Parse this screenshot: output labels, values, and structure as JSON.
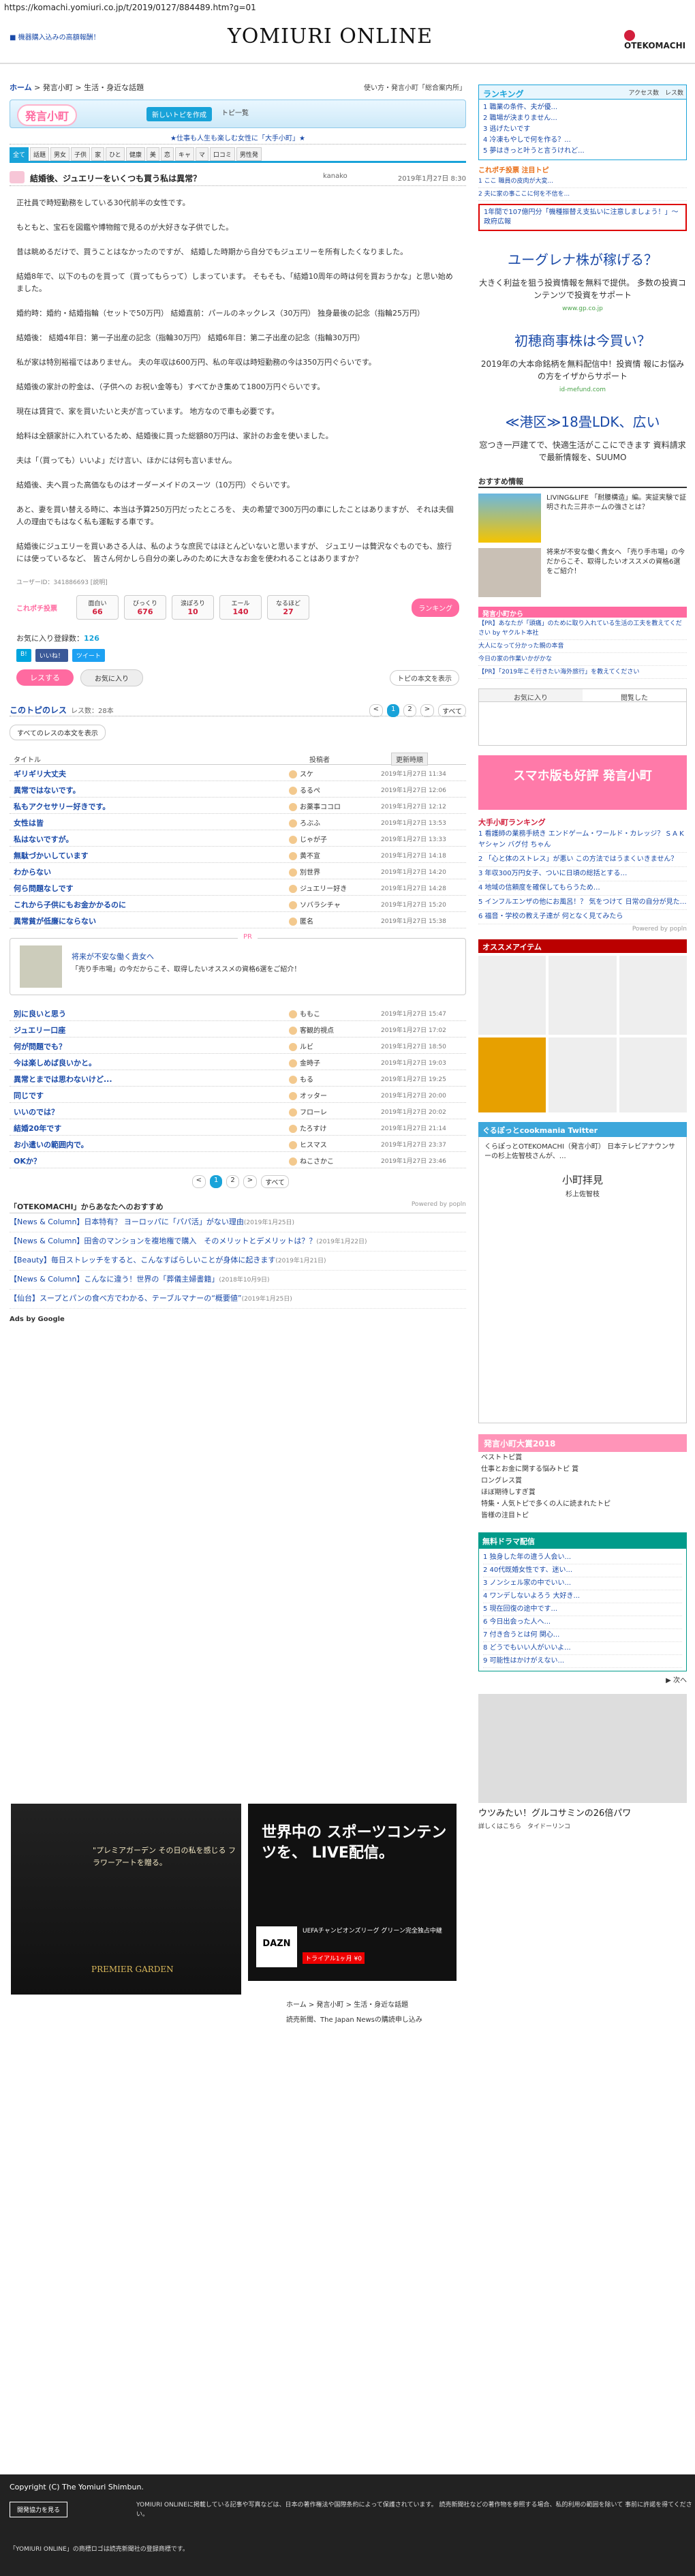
{
  "url": "https://komachi.yomiuri.co.jp/t/2019/0127/884489.htm?g=01",
  "top_link": "■ 機器購入込みの高額報酬！",
  "logo": "YOMIURI ONLINE",
  "otek": "OTEKOMACHI",
  "crumb": {
    "home": "ホーム",
    "path": " > 発言小町 > 生活・身近な話題",
    "right": "使い方・発言小町「総合案内所」"
  },
  "banner": {
    "logo": "発言小町",
    "new_topic": "新しいトピを作成",
    "button2": "トピ一覧"
  },
  "tagline": "★仕事も人生も楽しむ女性に「大手小町」★",
  "cat_tabs": [
    "全て",
    "話題",
    "男女",
    "子供",
    "家",
    "ひと",
    "健康",
    "美",
    "恋",
    "キャ",
    "マ",
    "口コミ",
    "男性発"
  ],
  "topic": {
    "title": "結婚後、ジュエリーをいくつも買う私は異常？",
    "user": "kanako",
    "date": "2019年1月27日 8:30"
  },
  "body": [
    "正社員で時短勤務をしている30代前半の女性です。",
    "もともと、宝石を図鑑や博物館で見るのが大好きな子供でした。",
    "昔は眺めるだけで、買うことはなかったのですが、 結婚した時期から自分でもジュエリーを所有したくなりました。",
    "結婚8年で、以下のものを買って（買ってもらって）しまっています。 そもそも、「結婚10周年の時は何を買おうかな」と思い始めました。",
    "婚約時：婚約・結婚指輪（セットで50万円） 結婚直前：パールのネックレス（30万円） 独身最後の記念（指輪25万円）",
    "結婚後： 結婚4年目：第一子出産の記念（指輪30万円） 結婚6年目：第二子出産の記念（指輪30万円）",
    "私が家は特別裕福ではありません。 夫の年収は600万円、私の年収は時短勤務の今は350万円ぐらいです。",
    "結婚後の家計の貯金は、（子供への お祝い金等も）すべてかき集めて1800万円ぐらいです。",
    "現在は賃貸で、家を買いたいと夫が言っています。 地方なので車も必要です。",
    "給料は全額家計に入れているため、結婚後に買った総額80万円は、家計のお金を使いました。",
    "夫は「（買っても）いいよ」だけ言い、ほかには何も言いません。",
    "結婚後、夫へ買った高価なものはオーダーメイドのスーツ（10万円）ぐらいです。",
    "あと、妻を買い替える時に、本当は予算250万円だったところを、 夫の希望で300万円の車にしたことはありますが、 それは夫個人の理由でもはなく私も運転する車です。",
    "結婚後にジュエリーを買いあさる人は、私のような庶民ではほとんどいないと思いますが、 ジュエリーは贅沢なぐものでも、旅行には使っているなど、 皆さん何かしら自分の楽しみのために大きなお金を使われることはありますか？"
  ],
  "user_id": "ユーザーID：341886693 [説明]",
  "reactions": {
    "label": "これポチ投票",
    "items": [
      {
        "name": "面白い",
        "count": "66"
      },
      {
        "name": "びっくり",
        "count": "676"
      },
      {
        "name": "涙ぽろり",
        "count": "10"
      },
      {
        "name": "エール",
        "count": "140"
      },
      {
        "name": "なるほど",
        "count": "27"
      }
    ],
    "ranking": "ランキング"
  },
  "fav": {
    "label": "お気に入り登録数：",
    "count": "126"
  },
  "share": [
    "B!",
    "いいね！",
    "ツイート"
  ],
  "actions": {
    "res": "レスする",
    "fav": "お気に入り",
    "top": "トピの本文を表示"
  },
  "res_head": {
    "title": "このトピのレス",
    "count": "レス数：28本"
  },
  "pager": [
    "<",
    "1",
    "2",
    ">",
    "すべて"
  ],
  "all_res": "すべてのレスの本文を表示",
  "list_head": {
    "title": "タイトル",
    "user": "投稿者",
    "sort": "更新時順"
  },
  "res": [
    {
      "t": "ギリギリ大丈夫",
      "u": "スケ",
      "d": "2019年1月27日 11:34"
    },
    {
      "t": "異常ではないです。",
      "u": "るるぺ",
      "d": "2019年1月27日 12:06"
    },
    {
      "t": "私もアクセサリー好きです。",
      "u": "お薬事ココロ",
      "d": "2019年1月27日 12:12"
    },
    {
      "t": "女性は皆",
      "u": "ろぶふ",
      "d": "2019年1月27日 13:53"
    },
    {
      "t": "私はないですが。",
      "u": "じゃが子",
      "d": "2019年1月27日 13:33"
    },
    {
      "t": "無駄づかいしています",
      "u": "黄不宣",
      "d": "2019年1月27日 14:18"
    },
    {
      "t": "わからない",
      "u": "別世界",
      "d": "2019年1月27日 14:20"
    },
    {
      "t": "何ら問題なしです",
      "u": "ジュエリー好き",
      "d": "2019年1月27日 14:28"
    },
    {
      "t": "これから子供にもお金かかるのに",
      "u": "ソバラシチャ",
      "d": "2019年1月27日 15:20"
    },
    {
      "t": "異常貧が低廉にならない",
      "u": "匿名",
      "d": "2019年1月27日 15:38"
    }
  ],
  "pr": {
    "label": "PR",
    "title": "将来が不安な働く貴女へ",
    "sub": "「売り手市場」の今だからこそ、取得したいオススメの資格6選をご紹介！"
  },
  "res2": [
    {
      "t": "別に良いと思う",
      "u": "ももこ",
      "d": "2019年1月27日 15:47"
    },
    {
      "t": "ジュエリー口座",
      "u": "客観的視点",
      "d": "2019年1月27日 17:02"
    },
    {
      "t": "何が問題でも？",
      "u": "ルビ",
      "d": "2019年1月27日 18:50"
    },
    {
      "t": "今は楽しめば良いかと。",
      "u": "金時子",
      "d": "2019年1月27日 19:03"
    },
    {
      "t": "異常とまでは思わないけど...",
      "u": "もる",
      "d": "2019年1月27日 19:25"
    },
    {
      "t": "同じです",
      "u": "オッター",
      "d": "2019年1月27日 20:00"
    },
    {
      "t": "いいのでは？",
      "u": "フローレ",
      "d": "2019年1月27日 20:02"
    },
    {
      "t": "結婚20年です",
      "u": "たろすけ",
      "d": "2019年1月27日 21:14"
    },
    {
      "t": "お小遣いの範囲内で。",
      "u": "ヒスマス",
      "d": "2019年1月27日 23:37"
    },
    {
      "t": "OKか？",
      "u": "ねこさかこ",
      "d": "2019年1月27日 23:46"
    }
  ],
  "rec": {
    "head": "「OTEKOMACHI」からあなたへのおすすめ",
    "powered": "Powered by popln",
    "items": [
      {
        "t": "【News & Column】日本特有？ ヨーロッパに「パパ活」がない理由",
        "d": "(2019年1月25日)"
      },
      {
        "t": "【News & Column】田舎のマンションを複地権で購入　そのメリットとデメリットは？？",
        "d": "(2019年1月22日)"
      },
      {
        "t": "【Beauty】毎日ストレッチをすると、こんなすばらしいことが身体に起きます",
        "d": "(2019年1月21日)"
      },
      {
        "t": "【News & Column】こんなに違う！世界の「葬儀主婦書籍」",
        "d": "(2018年10月9日)"
      },
      {
        "t": "【仙台】スープとパンの食べ方でわかる、テーブルマナーの“概要値”",
        "d": "(2019年1月25日)"
      }
    ]
  },
  "ads_google": "Ads by Google",
  "ad1": {
    "text": "\"プレミアガーデン その日の私を感じる フラワーアートを贈る。",
    "brand": "PREMIER GARDEN"
  },
  "ad2": {
    "head": "世界中の スポーツコンテンツを、 LIVE配信。",
    "logo": "DAZN",
    "sub": "UEFAチャンピオンズリーグ グリーン完全独占中継",
    "btn": "トライアル1ヶ月 ¥0"
  },
  "foot_crumb": "ホーム > 発言小町 > 生活・身近な話題",
  "foot_links": "読売新聞、The Japan Newsの購読申し込み",
  "right": {
    "rank_title": "ランキング",
    "rank_tabs": "アクセス数　レス数",
    "rank_items": [
      "1 職業の条件、夫が優...",
      "2 職場が決まりません...",
      "3 逃げたいです",
      "4 冷凍もやしで何を作る？...",
      "5 夢はきっと叶うと言うけれど..."
    ],
    "corei": "これポチ投票 注目トピ",
    "corei_list": [
      "1 ここ 職員の皮肉が大変...",
      "2 夫に家の事ここに何を不信を..."
    ],
    "red_box": "1年間で107億円分「機種振替え支払いに注意しましょう！」～政府広報",
    "ad1": {
      "h": "ユーグレナ株が稼げる？",
      "s": "大きく利益を狙う投資情報を無料で提供。 多数の投資コンテンツで投資をサポート",
      "u": "www.gp.co.jp"
    },
    "ad2": {
      "h": "初穂商事株は今買い？",
      "s": "2019年の大本命銘柄を無料配信中！投資情 報にお悩みの方をイザからサポート",
      "u": "id-mefund.com"
    },
    "ad3": {
      "h": "≪港区≫18畳LDK、広い",
      "s": "窓つき一戸建てで、快適生活がここにできます 資料請求で最新情報を、SUUMO",
      "u": ""
    },
    "osusume_head": "おすすめ情報",
    "osusume": [
      {
        "t": "LIVING&LIFE 「耐腰構造」編。実証実験で証明された三井ホームの強さとは？"
      },
      {
        "t": "将来が不安な働く貴女へ 「売り手市場」の今だからこそ、取得したいオススメの資格6選をご紹介！"
      }
    ],
    "hatsu_from": "発言小町から",
    "pr_lines": [
      "【PR】あなたが「頭痛」のために取り入れている生活の工夫を教えてください by ヤクルト本社",
      "大人になって分かった親の本音",
      "今日の家の作業いかがかな",
      "【PR】「2019年こそ行きたい海外旅行」を教えてください"
    ],
    "fav_tabs": [
      "お気に入り",
      "閲覧した"
    ],
    "smart": "スマホ版も好評 発言小町",
    "oote_head": "大手小町ランキング",
    "oote_list": [
      "1 看護師の業務手続き エンドゲーム・ワールド・カレッジ？ S A K ヤシャン バグ付 ちゃん",
      "2 「心と体のストレス」が悪い この方法ではうまくいきません？",
      "3 年収300万円女子、ついに日頃の総括とする…",
      "4 地域の信頼度を確保してもらうため…",
      "5 インフルエンザの他にお風呂！？ 気をつけて 日常の自分が見た…",
      "6 福音・学校の教え子達が 何となく見てみたら"
    ],
    "oote_powered": "Powered by popln",
    "osu_item": "オススメアイテム",
    "osu_labels": [
      "",
      "",
      "",
      "",
      "",
      ""
    ],
    "twitter": "ぐるぽっとcookmania Twitter",
    "tw_text": "くらぽっとOTEKOMACHI（発言小町） 日本テレビアナウンサーの杉上佐智枝さんが、…",
    "tw_name": "小町拝見",
    "tw_sub": "杉上佐智枝",
    "award": "発言小町大賞2018",
    "award_list": [
      "ベストトピ賞",
      "仕事とお金に関する悩みトピ 賞",
      "ロングレス賞",
      "ほぼ期待しすぎ賞",
      "特集・人気トピで多くの人に読まれたトピ",
      "皆様の注目トピ"
    ],
    "muryo": "無料ドラマ配信",
    "muryo_list": [
      "1 独身した年の違う人会い...",
      "2 40代既婚女性です、迷い...",
      "3 ノンシェル家の中でいい...",
      "4 ワンデしないよろう 大好き...",
      "5 現在回復の途中です...",
      "6 今日出会った人へ...",
      "7 付き合うとは何 関心...",
      "8 どうでもいい人がいいよ...",
      "9 可能性はかけがえない..."
    ],
    "muryo_btn": "▶ 次へ",
    "glucos_t": "ウツみたい！グルコサミンの26倍パワ",
    "glucos_b": "詳しくはこちら　タイドーリンコ"
  },
  "footer": {
    "copy": "Copyright (C) The Yomiuri Shimbun.",
    "btn": "開発協力を見る",
    "text": "YOMIURI ONLINEに掲載している記事や写真などは、日本の著作権法や国際条約によって保護されています。 読売新聞社などの著作物を参照する場合、私的利用の範囲を除いて 事前に許諾を得てください。",
    "text2": "「YOMIURI ONLINE」の商標ロゴは読売新聞社の登録商標です。"
  }
}
